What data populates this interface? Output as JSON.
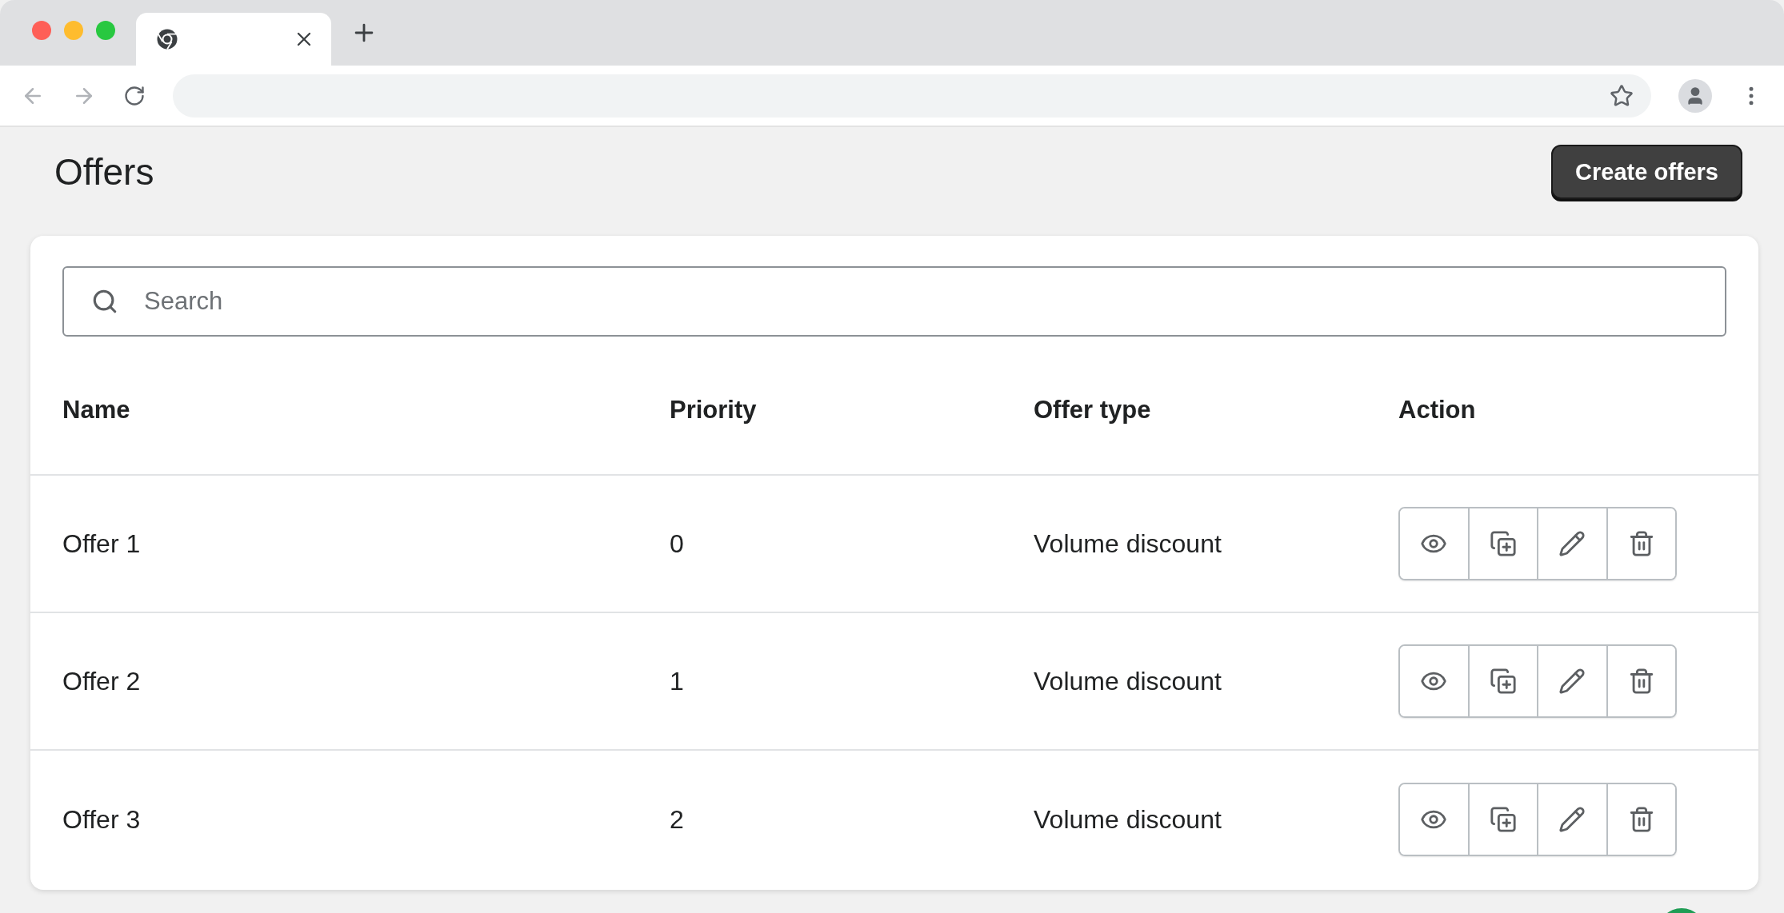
{
  "page": {
    "title": "Offers",
    "primary_button": "Create offers"
  },
  "search": {
    "placeholder": "Search"
  },
  "table": {
    "columns": [
      "Name",
      "Priority",
      "Offer type",
      "Action"
    ],
    "rows": [
      {
        "name": "Offer 1",
        "priority": "0",
        "offer_type": "Volume discount"
      },
      {
        "name": "Offer 2",
        "priority": "1",
        "offer_type": "Volume discount"
      },
      {
        "name": "Offer 3",
        "priority": "2",
        "offer_type": "Volume discount"
      }
    ]
  }
}
